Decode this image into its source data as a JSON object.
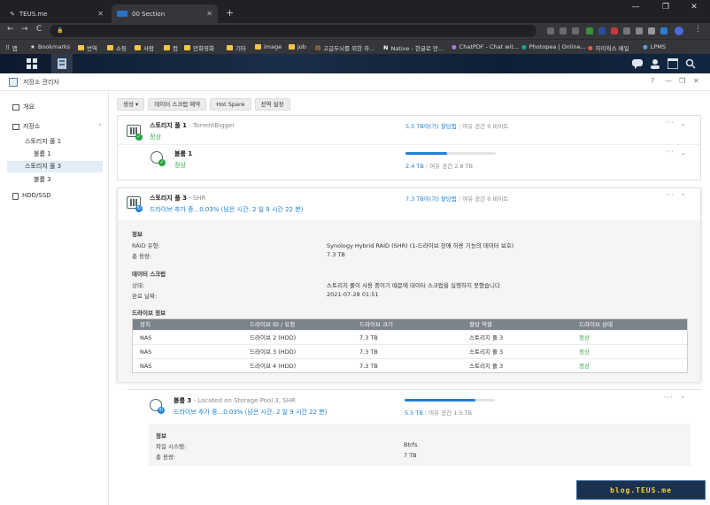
{
  "browser": {
    "tabs": [
      {
        "title": "TEUS.me",
        "close": "✕"
      },
      {
        "title": "00 Section",
        "close": "✕"
      }
    ],
    "new_tab": "+",
    "window_controls": [
      "—",
      "❐",
      "✕"
    ],
    "nav": {
      "back": "←",
      "forward": "→",
      "reload": "C"
    },
    "url": "",
    "bookmarks": [
      {
        "label": "앱",
        "type": "apps"
      },
      {
        "label": "Bookmarks",
        "type": "star"
      },
      {
        "label": "번역",
        "type": "folder"
      },
      {
        "label": "쇼핑",
        "type": "folder"
      },
      {
        "label": "사람",
        "type": "folder"
      },
      {
        "label": "컴",
        "type": "folder"
      },
      {
        "label": "만화영화",
        "type": "folder"
      },
      {
        "label": "기타",
        "type": "folder"
      },
      {
        "label": "image",
        "type": "folder"
      },
      {
        "label": "job",
        "type": "folder"
      },
      {
        "label": "고급두뇌를 위한 하...",
        "type": "site"
      },
      {
        "label": "Native - 한글로 만...",
        "type": "site"
      },
      {
        "label": "ChatPDF - Chat wit...",
        "type": "site"
      },
      {
        "label": "Photopea | Online...",
        "type": "site"
      },
      {
        "label": "하이웍스 메일",
        "type": "site"
      },
      {
        "label": "LPMS",
        "type": "site"
      }
    ]
  },
  "app": {
    "title": "저장소 관리자",
    "header_buttons": [
      "?",
      "—",
      "❐",
      "✕"
    ],
    "sidebar": {
      "items": [
        {
          "label": "개요",
          "icon": "overview-icon",
          "level": 0
        },
        {
          "label": "저장소",
          "icon": "storage-icon",
          "level": 0,
          "expanded": true
        },
        {
          "label": "스토리지 풀 1",
          "level": 1
        },
        {
          "label": "볼륨 1",
          "level": 2
        },
        {
          "label": "스토리지 풀 3",
          "level": 1,
          "selected": true
        },
        {
          "label": "볼륨 3",
          "level": 2
        },
        {
          "label": "HDD/SSD",
          "icon": "disk-icon",
          "level": 0
        }
      ]
    },
    "toolbar": {
      "create_label": "생성 ▾",
      "scrub_schedule_label": "데이터 스크럽 예약",
      "hot_spare_label": "Hot Spare",
      "global_settings_label": "전역 설정"
    },
    "pool1": {
      "title": "스토리지 풀 1",
      "subtitle": "- TorrentBigger",
      "status": "정상",
      "allocated": "5.5 TB이(가) 할당됨",
      "free": "여유 공간 0 바이트",
      "volume": {
        "title": "볼륨 1",
        "status": "정상",
        "used": "2.4 TB",
        "free": "여유 공간 2.8 TB",
        "usage_fraction": 0.46
      }
    },
    "pool3": {
      "title": "스토리지 풀 3",
      "subtitle": "- SHR",
      "status": "드라이브 추가 중...0.03% (남은 시간: 2 일 9 시간 22 분)",
      "allocated": "7.3 TB이(가) 할당됨",
      "free": "여유 공간 0 바이트",
      "info_heading": "정보",
      "raid_key": "RAID 유형:",
      "raid_value": "Synology Hybrid RAID (SHR) (1-드라이브 장애 허용 기능의 데이터 보호)",
      "capacity_key": "총 용량:",
      "capacity_value": "7.3 TB",
      "scrub_heading": "데이터 스크럽",
      "state_key": "상태:",
      "state_value": "스토리지 풀이 사용 중이기 때문에 데이터 스크럽을 실행하지 못했습니다",
      "completed_key": "완료 날짜:",
      "completed_value": "2021-07-28 01:51",
      "drive_heading": "드라이브 정보",
      "table": {
        "columns": [
          "장치",
          "드라이브 ID / 유형",
          "드라이브 크기",
          "할당 역할",
          "드라이브 상태"
        ],
        "rows": [
          [
            "NAS",
            "드라이브 2 (HDD)",
            "7.3 TB",
            "스토리지 풀 3",
            "정상"
          ],
          [
            "NAS",
            "드라이브 3 (HDD)",
            "7.3 TB",
            "스토리지 풀 3",
            "정상"
          ],
          [
            "NAS",
            "드라이브 4 (HDD)",
            "7.3 TB",
            "스토리지 풀 3",
            "정상"
          ]
        ]
      },
      "volume": {
        "title": "볼륨 3",
        "subtitle": "- Located on Storage Pool 3, SHR",
        "status": "드라이브 추가 중...0.03% (남은 시간: 2 일 9 시간 22 분)",
        "used": "5.5 TB",
        "free": "여유 공간 1.5 TB",
        "usage_fraction": 0.78,
        "info_heading": "정보",
        "fs_key": "파일 시스템:",
        "fs_value": "Btrfs",
        "capacity_key": "총 용량:",
        "capacity_value": "7 TB"
      }
    }
  },
  "watermark": "blog.TEUS.me",
  "colors": {
    "ok": "#2ca641",
    "busy": "#1a7fd1",
    "accent": "#1f7fd8"
  }
}
